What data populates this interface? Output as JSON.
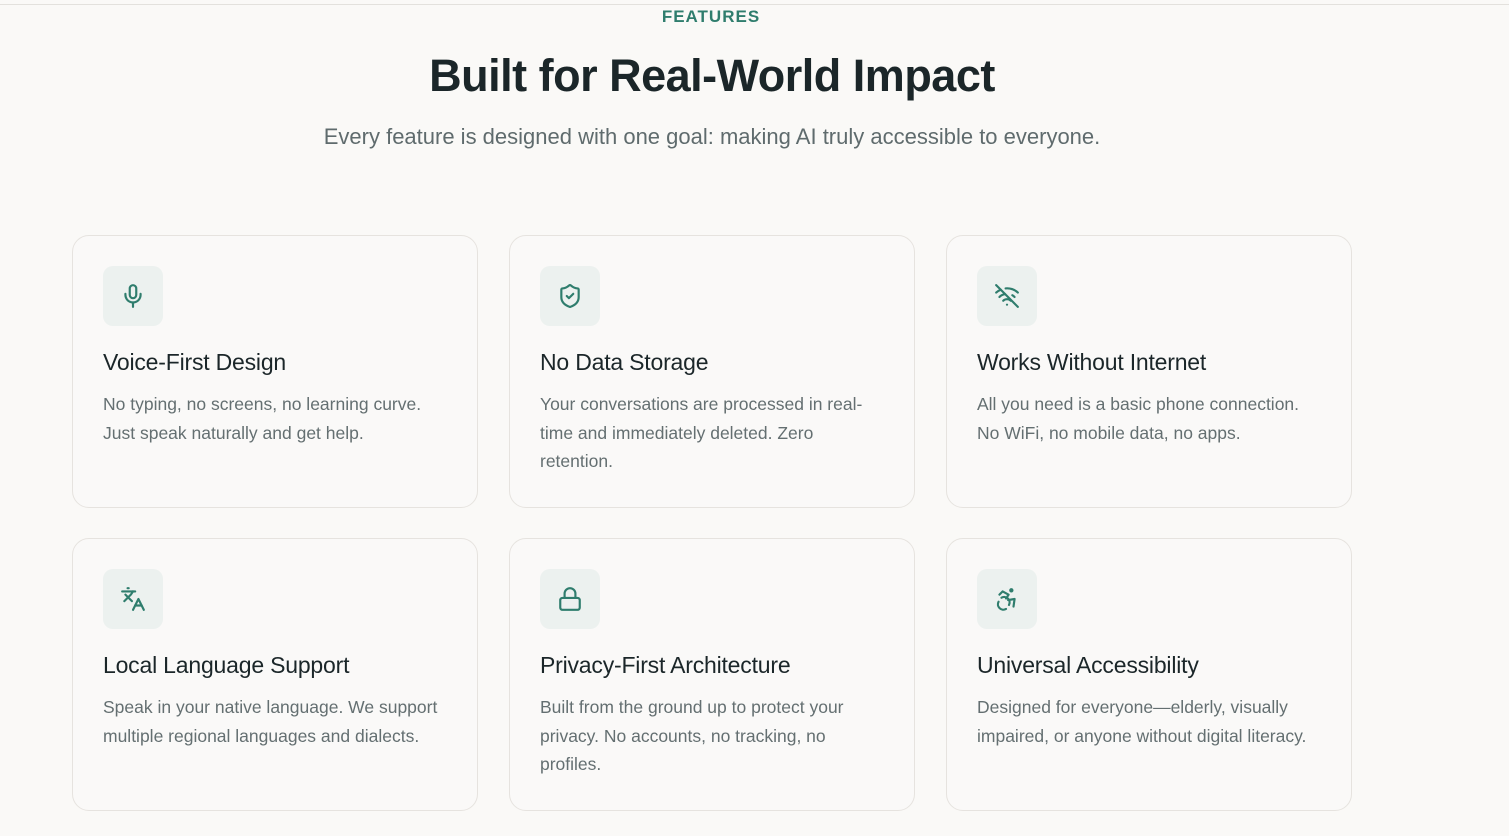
{
  "header": {
    "eyebrow": "FEATURES",
    "title": "Built for Real-World Impact",
    "subtitle": "Every feature is designed with one goal: making AI truly accessible to everyone."
  },
  "features": [
    {
      "icon": "microphone-icon",
      "title": "Voice-First Design",
      "description": "No typing, no screens, no learning curve. Just speak naturally and get help."
    },
    {
      "icon": "shield-check-icon",
      "title": "No Data Storage",
      "description": "Your conversations are processed in real-time and immediately deleted. Zero retention."
    },
    {
      "icon": "wifi-off-icon",
      "title": "Works Without Internet",
      "description": "All you need is a basic phone connection. No WiFi, no mobile data, no apps."
    },
    {
      "icon": "languages-icon",
      "title": "Local Language Support",
      "description": "Speak in your native language. We support multiple regional languages and dialects."
    },
    {
      "icon": "lock-icon",
      "title": "Privacy-First Architecture",
      "description": "Built from the ground up to protect your privacy. No accounts, no tracking, no profiles."
    },
    {
      "icon": "accessibility-icon",
      "title": "Universal Accessibility",
      "description": "Designed for everyone—elderly, visually impaired, or anyone without digital literacy."
    }
  ],
  "colors": {
    "accent": "#2f7d6d",
    "background": "#faf9f7",
    "icon_bg": "#ecf1ef",
    "heading": "#1b2629",
    "body_text": "#646f71"
  }
}
